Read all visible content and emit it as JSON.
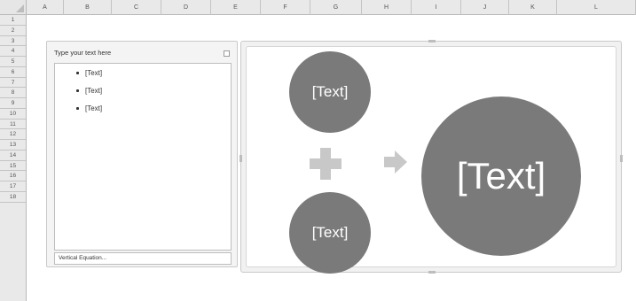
{
  "columns": [
    "A",
    "B",
    "C",
    "D",
    "E",
    "F",
    "G",
    "H",
    "I",
    "J",
    "K",
    "L"
  ],
  "rows": [
    "1",
    "2",
    "3",
    "4",
    "5",
    "6",
    "7",
    "8",
    "9",
    "10",
    "11",
    "12",
    "13",
    "14",
    "15",
    "16",
    "17",
    "18"
  ],
  "text_pane": {
    "title": "Type your text here",
    "bullets": [
      "[Text]",
      "[Text]",
      "[Text]"
    ],
    "footer": "Vertical Equation..."
  },
  "diagram": {
    "top_circle": "[Text]",
    "bottom_circle": "[Text]",
    "result_circle": "[Text]",
    "operator_icon": "plus-icon",
    "result_icon": "arrow-right-icon",
    "shape_color": "#7a7a7a",
    "operator_color": "#c8c8c8"
  }
}
